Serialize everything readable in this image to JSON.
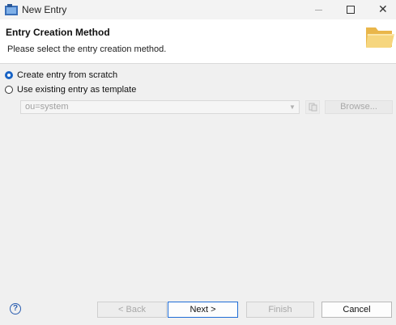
{
  "window": {
    "title": "New Entry"
  },
  "header": {
    "title": "Entry Creation Method",
    "description": "Please select the entry creation method."
  },
  "options": {
    "create_from_scratch": {
      "label": "Create entry from scratch",
      "checked": true
    },
    "use_template": {
      "label": "Use existing entry as template",
      "checked": false
    }
  },
  "template": {
    "value": "ou=system",
    "browse_label": "Browse..."
  },
  "footer": {
    "back_label": "< Back",
    "next_label": "Next >",
    "finish_label": "Finish",
    "cancel_label": "Cancel",
    "help_glyph": "?"
  },
  "colors": {
    "accent": "#1863c5",
    "folder": "#f2c75c"
  }
}
